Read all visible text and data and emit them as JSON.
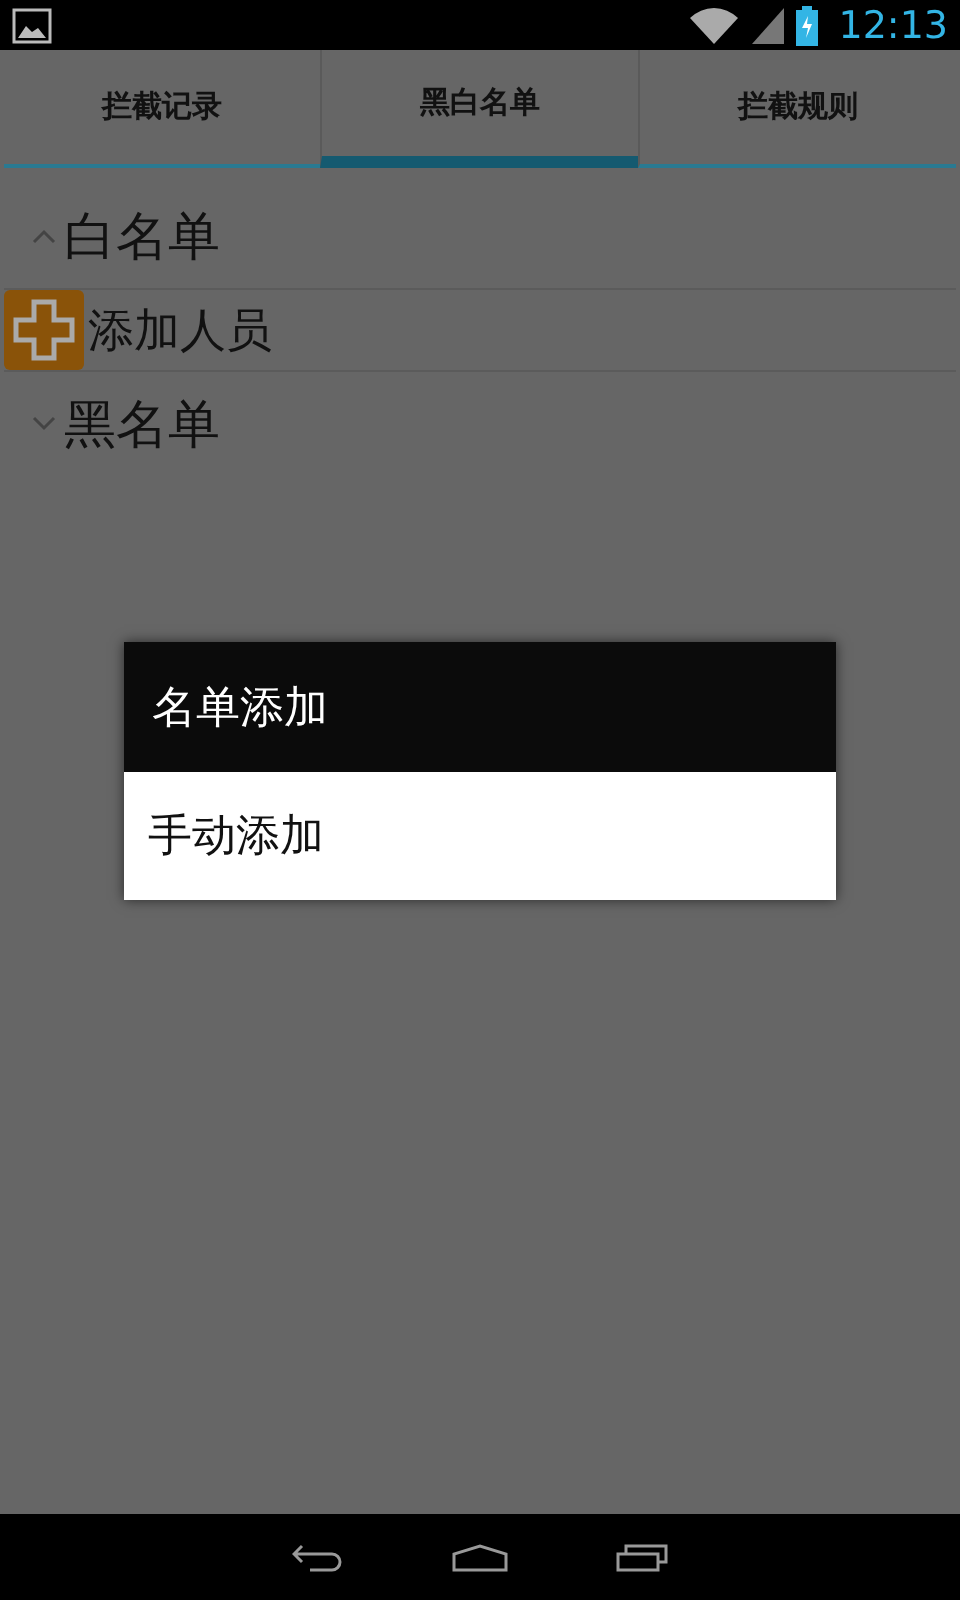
{
  "status_bar": {
    "time": "12:13"
  },
  "tabs": [
    {
      "label": "拦截记录",
      "selected": false
    },
    {
      "label": "黑白名单",
      "selected": true
    },
    {
      "label": "拦截规则",
      "selected": false
    }
  ],
  "groups": [
    {
      "title": "白名单",
      "expanded": true,
      "children": [
        {
          "label": "添加人员"
        }
      ]
    },
    {
      "title": "黑名单",
      "expanded": false
    }
  ],
  "dialog": {
    "title": "名单添加",
    "items": [
      "手动添加"
    ]
  }
}
